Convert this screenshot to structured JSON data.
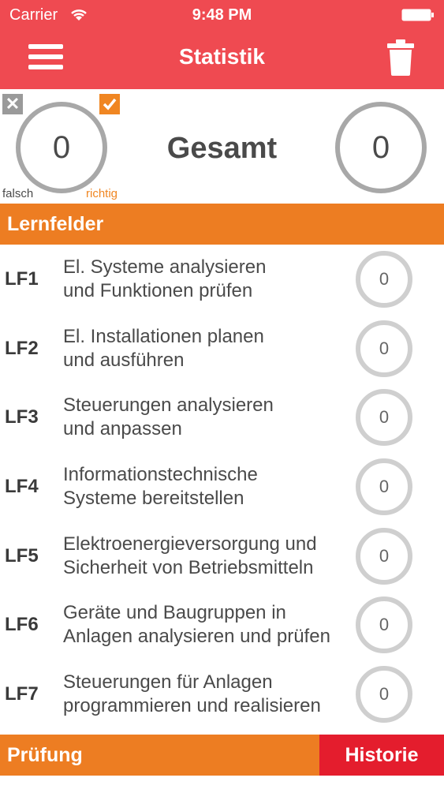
{
  "status_bar": {
    "carrier": "Carrier",
    "time": "9:48 PM"
  },
  "nav": {
    "title": "Statistik",
    "menu_icon": "menu-icon",
    "trash_icon": "trash-icon"
  },
  "summary": {
    "label": "Gesamt",
    "wrong_count": "0",
    "right_count": "0",
    "wrong_label": "falsch",
    "right_label": "richtig",
    "wrong_badge": "✕"
  },
  "sections": {
    "lernfelder": "Lernfelder"
  },
  "lernfelder": [
    {
      "code": "LF1",
      "line1": "El. Systeme analysieren",
      "line2": "und Funktionen prüfen",
      "count": "0"
    },
    {
      "code": "LF2",
      "line1": "El. Installationen planen",
      "line2": "und ausführen",
      "count": "0"
    },
    {
      "code": "LF3",
      "line1": "Steuerungen analysieren",
      "line2": "und anpassen",
      "count": "0"
    },
    {
      "code": "LF4",
      "line1": "Informationstechnische",
      "line2": "Systeme bereitstellen",
      "count": "0"
    },
    {
      "code": "LF5",
      "line1": "Elektroenergieversorgung und",
      "line2": "Sicherheit von Betriebsmitteln",
      "count": "0"
    },
    {
      "code": "LF6",
      "line1": "Geräte und Baugruppen in",
      "line2": "Anlagen analysieren und prüfen",
      "count": "0"
    },
    {
      "code": "LF7",
      "line1": "Steuerungen für Anlagen",
      "line2": "programmieren und realisieren",
      "count": "0"
    }
  ],
  "bottom": {
    "pruefung": "Prüfung",
    "historie": "Historie"
  },
  "colors": {
    "header": "#ef4a51",
    "orange": "#ed7d22",
    "red_tab": "#e41d2d",
    "ring": "#a8a8a8"
  }
}
